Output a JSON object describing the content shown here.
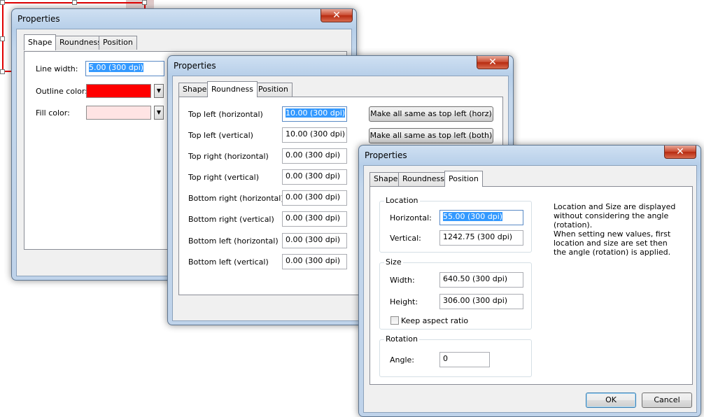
{
  "dialogs": {
    "shape": {
      "title": "Properties",
      "close_label": "✕",
      "tabs": [
        "Shape",
        "Roundness",
        "Position"
      ],
      "fields": {
        "line_width_label": "Line width:",
        "line_width_value": "5.00 (300 dpi)",
        "outline_color_label": "Outline color:",
        "outline_color": "#ff0000",
        "fill_color_label": "Fill color:",
        "fill_color": "#ffe4e4"
      }
    },
    "roundness": {
      "title": "Properties",
      "close_label": "✕",
      "tabs": [
        "Shape",
        "Roundness",
        "Position"
      ],
      "rows": [
        {
          "label": "Top left (horizontal)",
          "value": "10.00 (300 dpi)"
        },
        {
          "label": "Top left (vertical)",
          "value": "10.00 (300 dpi)"
        },
        {
          "label": "Top right (horizontal)",
          "value": "0.00 (300 dpi)"
        },
        {
          "label": "Top right (vertical)",
          "value": "0.00 (300 dpi)"
        },
        {
          "label": "Bottom right (horizontal)",
          "value": "0.00 (300 dpi)"
        },
        {
          "label": "Bottom right (vertical)",
          "value": "0.00 (300 dpi)"
        },
        {
          "label": "Bottom left (horizontal)",
          "value": "0.00 (300 dpi)"
        },
        {
          "label": "Bottom left (vertical)",
          "value": "0.00 (300 dpi)"
        }
      ],
      "make_same_horz_label": "Make all same as top left (horz)",
      "make_same_both_label": "Make all same as top left (both)"
    },
    "position": {
      "title": "Properties",
      "close_label": "✕",
      "tabs": [
        "Shape",
        "Roundness",
        "Position"
      ],
      "location_group": "Location",
      "horizontal_label": "Horizontal:",
      "horizontal_value": "55.00 (300 dpi)",
      "vertical_label": "Vertical:",
      "vertical_value": "1242.75 (300 dpi)",
      "size_group": "Size",
      "width_label": "Width:",
      "width_value": "640.50 (300 dpi)",
      "height_label": "Height:",
      "height_value": "306.00 (300 dpi)",
      "keep_aspect_label": "Keep aspect ratio",
      "rotation_group": "Rotation",
      "angle_label": "Angle:",
      "angle_value": "0",
      "note_line1": "Location and Size are displayed without considering the angle (rotation).",
      "note_line2": "When setting new values, first location and size are set then the angle (rotation) is applied.",
      "ok_label": "OK",
      "cancel_label": "Cancel"
    }
  },
  "icons": {
    "dropdown_arrow": "▼",
    "close": "close-icon"
  }
}
